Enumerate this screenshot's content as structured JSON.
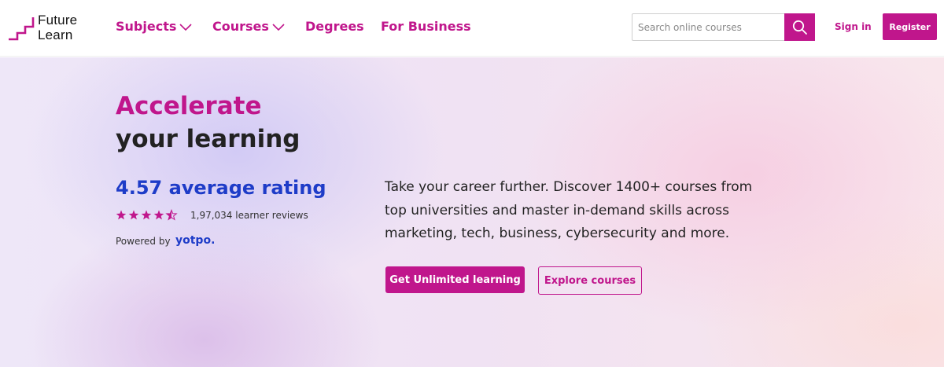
{
  "header": {
    "logo": {
      "line1": "Future",
      "line2": "Learn"
    },
    "nav": [
      {
        "label": "Subjects",
        "has_dropdown": true
      },
      {
        "label": "Courses",
        "has_dropdown": true
      },
      {
        "label": "Degrees",
        "has_dropdown": false
      },
      {
        "label": "For Business",
        "has_dropdown": false
      }
    ],
    "search": {
      "placeholder": "Search online courses",
      "value": "",
      "icon": "search-icon"
    },
    "sign_in": "Sign in",
    "register": "Register"
  },
  "hero": {
    "headline_accent": "Accelerate",
    "headline": "your learning",
    "rating_text": "4.57 average rating",
    "rating_stars": 4.5,
    "stars_max": 5,
    "reviews": "1,97,034 learner reviews",
    "powered_by": "Powered by",
    "powered_brand": "yotpo.",
    "description": "Take your career further. Discover 1400+ courses from top universities and master in-demand skills across marketing, tech, business, cybersecurity and more.",
    "primary_cta": "Get Unlimited learning",
    "secondary_cta": "Explore courses"
  },
  "colors": {
    "brand": "#c0168c",
    "rating_blue": "#1e3cc8",
    "text_dark": "#222222"
  }
}
